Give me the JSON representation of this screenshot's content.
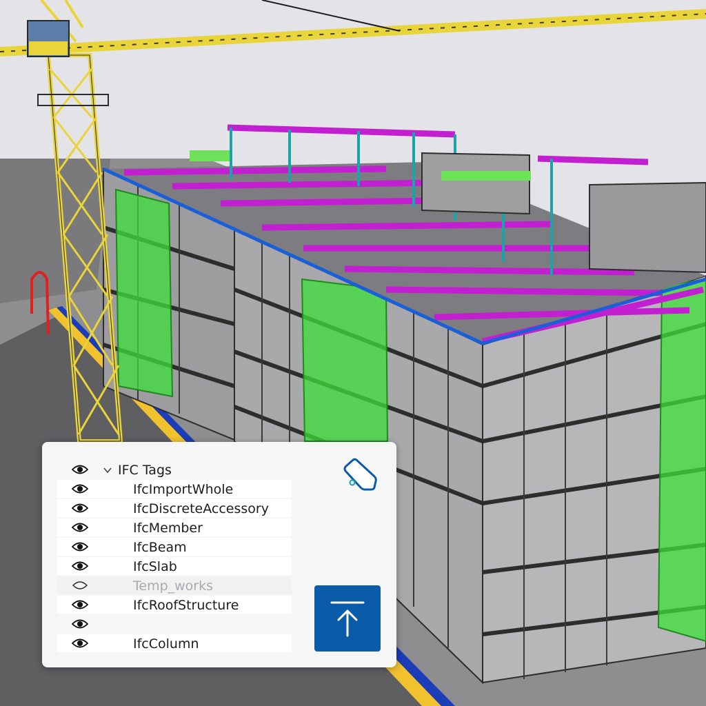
{
  "panel": {
    "header": {
      "label": "IFC Tags",
      "visible": true,
      "expanded": true
    },
    "items": [
      {
        "label": "IfcImportWhole",
        "visible": true
      },
      {
        "label": "IfcDiscreteAccessory",
        "visible": true
      },
      {
        "label": "IfcMember",
        "visible": true
      },
      {
        "label": "IfcBeam",
        "visible": true
      },
      {
        "label": "IfcSlab",
        "visible": true
      },
      {
        "label": "Temp_works",
        "visible": false
      },
      {
        "label": "IfcRoofStructure",
        "visible": true
      },
      {
        "label": "",
        "visible": true
      },
      {
        "label": "IfcColumn",
        "visible": true
      }
    ],
    "tag_icon": "tag-icon",
    "upload_icon": "upload-arrow-icon"
  },
  "colors": {
    "accent": "#0b5ca8",
    "beams": "#c21fd0",
    "stair_cores": "#3de03a",
    "crane": "#e9d43a",
    "scaffold": "#2d2d2d",
    "ground_stripe": "#f2c12e",
    "ground_edge": "#1b3db8"
  }
}
